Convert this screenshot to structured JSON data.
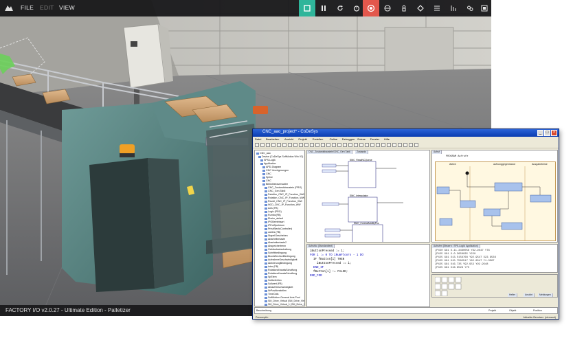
{
  "factoryio": {
    "menu": {
      "file": "FILE",
      "edit": "EDIT",
      "view": "VIEW"
    },
    "toolbar": {
      "icons": [
        "play-icon",
        "pause-icon",
        "reset-icon",
        "timer-icon",
        "record-icon",
        "camera-icon",
        "first-person-icon",
        "fly-icon",
        "list-icon",
        "sensors-icon",
        "drivers-icon",
        "fullscreen-icon"
      ]
    },
    "status": "FACTORY I/O v2.0.27 - Ultimate Edition - Palletizer",
    "colors": {
      "accent_green": "#2fb59a",
      "accent_red": "#e2574c",
      "topbar": "#141416"
    }
  },
  "codesys": {
    "title": "CNC_aao_project* - CoDeSys",
    "menu": [
      "Datei",
      "Bearbeiten",
      "Ansicht",
      "Projekt",
      "Erstellen",
      "Online",
      "Debuggen",
      "Extras",
      "Fenster",
      "Hilfe"
    ],
    "tree": {
      "items": [
        "CNC_aao",
        "Device (CoDeSys SoftMotion Win V3)",
        "SPS-Logik",
        "Applikation",
        "APD-Diagram",
        "CNC Verzögerungen",
        "CNC",
        "Spline",
        "CNC",
        "Bibliotheksverwalter",
        "CNC_Zustandsbaustein (PRG)",
        "CNC_Gen.Tab6",
        "Palettier_CNC_IP_Function_WW",
        "Rotation_CNC_IP_Function_WW",
        "Revolt_CNC_IP_Function_WW",
        "NCD_CNC_IP_Function_WW",
        "Axis (FB)",
        "Logic (PRG)",
        "Rumbo(FB)",
        "Eheim_ablauf",
        "IPOBetriebsart",
        "IPEntSpektrum",
        "PrinzBlech(Controller)",
        "cables (FB)",
        "StapelGeschehen",
        "Abarbeitentaste",
        "Abarbeitentaste2",
        "Abspeichertrenn",
        "Gebäudeabschaltung",
        "Schrittbedingung",
        "BlockWechselBedingung",
        "AufnahmeGeschwindigkeit",
        "AktivierungBedingung",
        "Inter (FB)",
        "RotationsKanalsSchoffung",
        "RotationsKanalsSchoffung",
        "SpElem",
        "Sollbefehlen",
        "Sollwert (FB)",
        "AblaufGeschwindigkeit",
        "NrPositionstellen",
        "TimeOuts",
        "SoftMotion General Axis Pool",
        "SM_Drive_Virtual (SM_Drive_Virtual)",
        "SM_Drive_Virtual_1 (SM_Drive_Virtual)"
      ]
    },
    "fbd": {
      "tab": "CNC_Zustandsbaustein/CNC_Gen.Tab6",
      "tab2": "Zustands",
      "blocks": [
        "SMC_ReadNCQueue",
        "SMC_Interpolator",
        "SMC_ControlAxisByPos"
      ]
    },
    "sfc": {
      "tab": "Aufruf",
      "title": "PROGRAM Aufrufe",
      "col1": "Aktive",
      "col2": "aufnunggegenstand",
      "col3": "Ausgabebeise"
    },
    "st": {
      "tab": "Aufrufdo (Standardtext)",
      "lines": [
        "iButtonPressed := 1;",
        "FOR i := 0 TO iNumFloors - 1 DO",
        "  IF fButton[i] THEN",
        "    iButtonPressed := i;",
        "  END_IF",
        "  fButton[i] := FALSE;",
        "END_FOR"
      ]
    },
    "watch": {
      "tab": "Aufrufen [Steuern : SPS-Logik: Applikation]",
      "lines": [
        "{P450 G91 X-11.3460056 Y92.9547 Y76",
        "{P425 G91 X-0.3650035 Y220",
        "{P425 G91 X13.5156768 Y92.9547 X22.9536",
        "{P425 G91 X15.7582517 Y92.9547 Y1.3567",
        "{P425 G91 X16.735 Y92.953 Y92.9548",
        "{P425 G91 X16.6529 Y75"
      ]
    },
    "messages": {
      "tab": "Meldungen",
      "col1": "Beschreibung",
      "col2": "Projekt",
      "col3": "Objekt",
      "col4": "Position"
    },
    "props_tabs": [
      "Helfer",
      "Ansicht",
      "Meldungen"
    ],
    "statusbar": {
      "left": "Precompile:",
      "right": "Aktueller Benutzer: (niemand)"
    }
  }
}
